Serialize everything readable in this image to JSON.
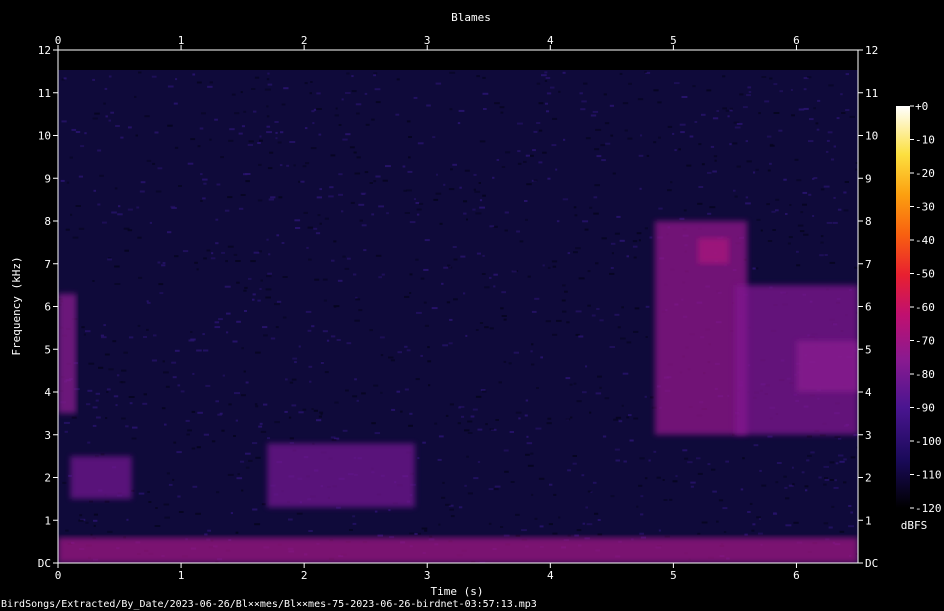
{
  "chart_data": {
    "type": "heatmap",
    "title": "Blames",
    "xlabel": "Time (s)",
    "ylabel": "Frequency (kHz)",
    "xlim": [
      0,
      6.5
    ],
    "ylim": [
      0,
      12
    ],
    "x_ticks": [
      "0",
      "1",
      "2",
      "3",
      "4",
      "5",
      "6"
    ],
    "y_ticks": [
      "DC",
      "1",
      "2",
      "3",
      "4",
      "5",
      "6",
      "7",
      "8",
      "9",
      "10",
      "11",
      "12"
    ],
    "colorbar": {
      "label": "dBFS",
      "range": [
        -120,
        0
      ],
      "ticks": [
        "+0",
        "-10",
        "-20",
        "-30",
        "-40",
        "-50",
        "-60",
        "-70",
        "-80",
        "-90",
        "-100",
        "-110",
        "-120"
      ],
      "colors": [
        "#000000",
        "#1a0a5a",
        "#4a1590",
        "#8a1a90",
        "#c01070",
        "#e82030",
        "#f86010",
        "#fca010",
        "#fce040",
        "#ffffff"
      ]
    },
    "background_color": "#0f0a3a",
    "energy_regions": [
      {
        "t_start": 0.0,
        "t_end": 0.15,
        "f_low": 3.5,
        "f_high": 6.3,
        "level_db": -80
      },
      {
        "t_start": 0.0,
        "t_end": 6.5,
        "f_low": 0.0,
        "f_high": 0.6,
        "level_db": -75
      },
      {
        "t_start": 0.1,
        "t_end": 0.6,
        "f_low": 1.5,
        "f_high": 2.5,
        "level_db": -85
      },
      {
        "t_start": 1.7,
        "t_end": 2.9,
        "f_low": 1.3,
        "f_high": 2.8,
        "level_db": -85
      },
      {
        "t_start": 4.85,
        "t_end": 5.6,
        "f_low": 3.0,
        "f_high": 8.0,
        "level_db": -78
      },
      {
        "t_start": 5.2,
        "t_end": 5.45,
        "f_low": 7.0,
        "f_high": 7.6,
        "level_db": -72
      },
      {
        "t_start": 5.5,
        "t_end": 6.5,
        "f_low": 3.0,
        "f_high": 6.5,
        "level_db": -82
      },
      {
        "t_start": 6.0,
        "t_end": 6.5,
        "f_low": 4.0,
        "f_high": 5.2,
        "level_db": -80
      }
    ]
  },
  "footer": {
    "file_path": "BirdSongs/Extracted/By_Date/2023-06-26/Bl××mes/Bl××mes-75-2023-06-26-birdnet-03:57:13.mp3"
  }
}
